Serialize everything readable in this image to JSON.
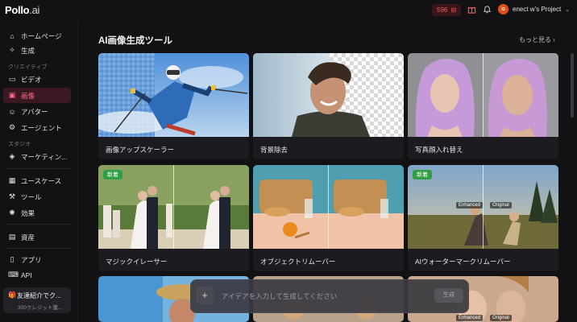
{
  "header": {
    "logo_main": "Pollo",
    "logo_suffix": ".ai",
    "credits": "596",
    "project": "enect w's Project",
    "avatar_initial": "o"
  },
  "sidebar": {
    "items": [
      {
        "label": "ホームページ",
        "icon": "home-icon"
      },
      {
        "label": "生成",
        "icon": "sparkle-icon"
      },
      {
        "label": "ビデオ",
        "icon": "video-icon"
      },
      {
        "label": "画像",
        "icon": "image-icon"
      },
      {
        "label": "アバター",
        "icon": "avatar-icon"
      },
      {
        "label": "エージェント",
        "icon": "agent-icon"
      },
      {
        "label": "マーケティン...",
        "icon": "marketing-icon"
      },
      {
        "label": "ユースケース",
        "icon": "usecase-icon"
      },
      {
        "label": "ツール",
        "icon": "tools-icon"
      },
      {
        "label": "効果",
        "icon": "effects-icon"
      },
      {
        "label": "資産",
        "icon": "assets-icon"
      },
      {
        "label": "アプリ",
        "icon": "app-icon"
      },
      {
        "label": "API",
        "icon": "api-icon"
      }
    ],
    "sections": {
      "creative": "クリエイティブ",
      "studio": "スタジオ"
    },
    "invite": {
      "title": "友達紹介でク...",
      "subtitle": "300クレジット獲..."
    }
  },
  "main": {
    "title": "AI画像生成ツール",
    "more": "もっと見る",
    "badge_new": "新着",
    "tag_enhanced": "Enhanced",
    "tag_original": "Original",
    "cards": [
      {
        "label": "画像アップスケーラー"
      },
      {
        "label": "背景除去"
      },
      {
        "label": "写真顔入れ替え"
      },
      {
        "label": "マジックイレーサー"
      },
      {
        "label": "オブジェクトリムーバー"
      },
      {
        "label": "AIウォーターマークリムーバー"
      }
    ]
  },
  "prompt": {
    "placeholder": "アイデアを入力して生成してください",
    "generate": "生成"
  },
  "colors": {
    "accent": "#ff6a86",
    "active_bg": "#3a1922",
    "badge_green": "#2f9e44"
  }
}
